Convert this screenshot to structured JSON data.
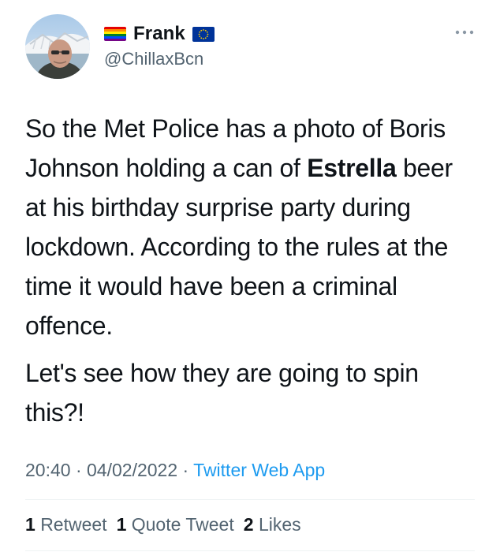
{
  "author": {
    "display_name": "Frank",
    "handle": "@ChillaxBcn",
    "rainbow_colors": [
      "#e40303",
      "#ff8c00",
      "#ffed00",
      "#008026",
      "#004dff",
      "#750787"
    ],
    "eu_flag_colors": {
      "blue": "#003399",
      "star": "#ffcc00"
    },
    "avatar": "profile-photo"
  },
  "tweet": {
    "text_before_bold": "So the Met Police has a photo of Boris Johnson holding a can of ",
    "bold": "Estrella",
    "text_after_bold": " beer at his birthday surprise party during lockdown. According to the rules at the time it would have been a criminal offence.",
    "paragraph_2": "Let's see how they are going to spin this?!"
  },
  "meta": {
    "time": "20:40",
    "separator": " · ",
    "date": "04/02/2022",
    "source": "Twitter Web App",
    "link_color": "#1d9bf0"
  },
  "stats": {
    "retweets_count": "1",
    "retweets_label": "Retweet",
    "quote_count": "1",
    "quote_label": "Quote Tweet",
    "likes_count": "2",
    "likes_label": "Likes"
  },
  "icons": {
    "more": "more-horizontal-icon"
  }
}
